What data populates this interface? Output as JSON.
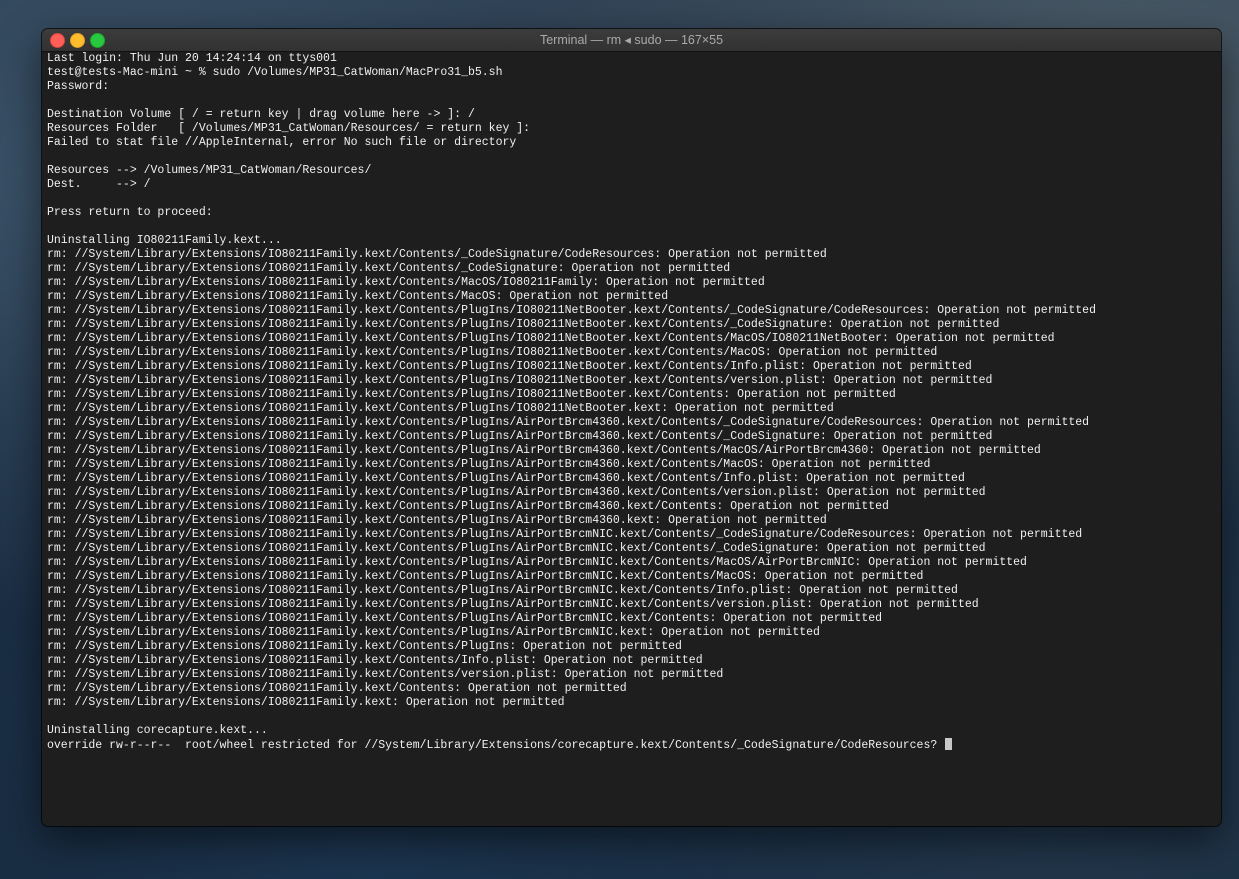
{
  "window": {
    "title": "Terminal — rm ◂ sudo — 167×55"
  },
  "terminal": {
    "lines": [
      "Last login: Thu Jun 20 14:24:14 on ttys001",
      "test@tests-Mac-mini ~ % sudo /Volumes/MP31_CatWoman/MacPro31_b5.sh",
      "Password:",
      "",
      "Destination Volume [ / = return key | drag volume here -> ]: /",
      "Resources Folder   [ /Volumes/MP31_CatWoman/Resources/ = return key ]:",
      "Failed to stat file //AppleInternal, error No such file or directory",
      "",
      "Resources --> /Volumes/MP31_CatWoman/Resources/",
      "Dest.     --> /",
      "",
      "Press return to proceed:",
      "",
      "Uninstalling IO80211Family.kext...",
      "rm: //System/Library/Extensions/IO80211Family.kext/Contents/_CodeSignature/CodeResources: Operation not permitted",
      "rm: //System/Library/Extensions/IO80211Family.kext/Contents/_CodeSignature: Operation not permitted",
      "rm: //System/Library/Extensions/IO80211Family.kext/Contents/MacOS/IO80211Family: Operation not permitted",
      "rm: //System/Library/Extensions/IO80211Family.kext/Contents/MacOS: Operation not permitted",
      "rm: //System/Library/Extensions/IO80211Family.kext/Contents/PlugIns/IO80211NetBooter.kext/Contents/_CodeSignature/CodeResources: Operation not permitted",
      "rm: //System/Library/Extensions/IO80211Family.kext/Contents/PlugIns/IO80211NetBooter.kext/Contents/_CodeSignature: Operation not permitted",
      "rm: //System/Library/Extensions/IO80211Family.kext/Contents/PlugIns/IO80211NetBooter.kext/Contents/MacOS/IO80211NetBooter: Operation not permitted",
      "rm: //System/Library/Extensions/IO80211Family.kext/Contents/PlugIns/IO80211NetBooter.kext/Contents/MacOS: Operation not permitted",
      "rm: //System/Library/Extensions/IO80211Family.kext/Contents/PlugIns/IO80211NetBooter.kext/Contents/Info.plist: Operation not permitted",
      "rm: //System/Library/Extensions/IO80211Family.kext/Contents/PlugIns/IO80211NetBooter.kext/Contents/version.plist: Operation not permitted",
      "rm: //System/Library/Extensions/IO80211Family.kext/Contents/PlugIns/IO80211NetBooter.kext/Contents: Operation not permitted",
      "rm: //System/Library/Extensions/IO80211Family.kext/Contents/PlugIns/IO80211NetBooter.kext: Operation not permitted",
      "rm: //System/Library/Extensions/IO80211Family.kext/Contents/PlugIns/AirPortBrcm4360.kext/Contents/_CodeSignature/CodeResources: Operation not permitted",
      "rm: //System/Library/Extensions/IO80211Family.kext/Contents/PlugIns/AirPortBrcm4360.kext/Contents/_CodeSignature: Operation not permitted",
      "rm: //System/Library/Extensions/IO80211Family.kext/Contents/PlugIns/AirPortBrcm4360.kext/Contents/MacOS/AirPortBrcm4360: Operation not permitted",
      "rm: //System/Library/Extensions/IO80211Family.kext/Contents/PlugIns/AirPortBrcm4360.kext/Contents/MacOS: Operation not permitted",
      "rm: //System/Library/Extensions/IO80211Family.kext/Contents/PlugIns/AirPortBrcm4360.kext/Contents/Info.plist: Operation not permitted",
      "rm: //System/Library/Extensions/IO80211Family.kext/Contents/PlugIns/AirPortBrcm4360.kext/Contents/version.plist: Operation not permitted",
      "rm: //System/Library/Extensions/IO80211Family.kext/Contents/PlugIns/AirPortBrcm4360.kext/Contents: Operation not permitted",
      "rm: //System/Library/Extensions/IO80211Family.kext/Contents/PlugIns/AirPortBrcm4360.kext: Operation not permitted",
      "rm: //System/Library/Extensions/IO80211Family.kext/Contents/PlugIns/AirPortBrcmNIC.kext/Contents/_CodeSignature/CodeResources: Operation not permitted",
      "rm: //System/Library/Extensions/IO80211Family.kext/Contents/PlugIns/AirPortBrcmNIC.kext/Contents/_CodeSignature: Operation not permitted",
      "rm: //System/Library/Extensions/IO80211Family.kext/Contents/PlugIns/AirPortBrcmNIC.kext/Contents/MacOS/AirPortBrcmNIC: Operation not permitted",
      "rm: //System/Library/Extensions/IO80211Family.kext/Contents/PlugIns/AirPortBrcmNIC.kext/Contents/MacOS: Operation not permitted",
      "rm: //System/Library/Extensions/IO80211Family.kext/Contents/PlugIns/AirPortBrcmNIC.kext/Contents/Info.plist: Operation not permitted",
      "rm: //System/Library/Extensions/IO80211Family.kext/Contents/PlugIns/AirPortBrcmNIC.kext/Contents/version.plist: Operation not permitted",
      "rm: //System/Library/Extensions/IO80211Family.kext/Contents/PlugIns/AirPortBrcmNIC.kext/Contents: Operation not permitted",
      "rm: //System/Library/Extensions/IO80211Family.kext/Contents/PlugIns/AirPortBrcmNIC.kext: Operation not permitted",
      "rm: //System/Library/Extensions/IO80211Family.kext/Contents/PlugIns: Operation not permitted",
      "rm: //System/Library/Extensions/IO80211Family.kext/Contents/Info.plist: Operation not permitted",
      "rm: //System/Library/Extensions/IO80211Family.kext/Contents/version.plist: Operation not permitted",
      "rm: //System/Library/Extensions/IO80211Family.kext/Contents: Operation not permitted",
      "rm: //System/Library/Extensions/IO80211Family.kext: Operation not permitted",
      "",
      "Uninstalling corecapture.kext...",
      "override rw-r--r--  root/wheel restricted for //System/Library/Extensions/corecapture.kext/Contents/_CodeSignature/CodeResources? "
    ]
  },
  "colors": {
    "terminal_bg": "#1e1e1e",
    "terminal_fg": "#f0f0f0",
    "close": "#ff5f57",
    "minimize": "#febc2e",
    "zoom": "#28c840"
  }
}
